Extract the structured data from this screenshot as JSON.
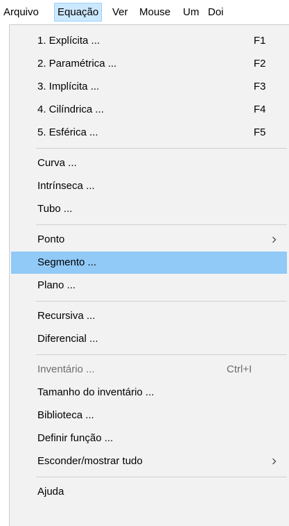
{
  "menubar": {
    "items": [
      {
        "label": "Arquivo"
      },
      {
        "label": "Equação"
      },
      {
        "label": "Ver"
      },
      {
        "label": "Mouse"
      },
      {
        "label": "Um"
      },
      {
        "label": "Doi"
      }
    ]
  },
  "menu": {
    "items": [
      {
        "label": "1. Explícita ...",
        "shortcut": "F1"
      },
      {
        "label": "2. Paramétrica ...",
        "shortcut": "F2"
      },
      {
        "label": "3. Implícita ...",
        "shortcut": "F3"
      },
      {
        "label": "4. Cilíndrica ...",
        "shortcut": "F4"
      },
      {
        "label": "5. Esférica ...",
        "shortcut": "F5"
      },
      {
        "label": "Curva ..."
      },
      {
        "label": "Intrínseca ..."
      },
      {
        "label": "Tubo ..."
      },
      {
        "label": "Ponto",
        "submenu": true
      },
      {
        "label": "Segmento ...",
        "highlighted": true
      },
      {
        "label": "Plano ..."
      },
      {
        "label": "Recursiva ..."
      },
      {
        "label": "Diferencial ..."
      },
      {
        "label": "Inventário ...",
        "shortcut": "Ctrl+I",
        "disabled": true
      },
      {
        "label": "Tamanho do inventário ..."
      },
      {
        "label": "Biblioteca ..."
      },
      {
        "label": "Definir função ..."
      },
      {
        "label": "Esconder/mostrar tudo",
        "submenu": true
      },
      {
        "label": "Ajuda"
      }
    ]
  },
  "colors": {
    "menubar_active_bg": "#cce8ff",
    "highlight_bg": "#91c9f7",
    "menu_bg": "#f2f2f2",
    "disabled_text": "#6d6d6d"
  },
  "icons": {
    "submenu": "chevron-right-icon"
  }
}
